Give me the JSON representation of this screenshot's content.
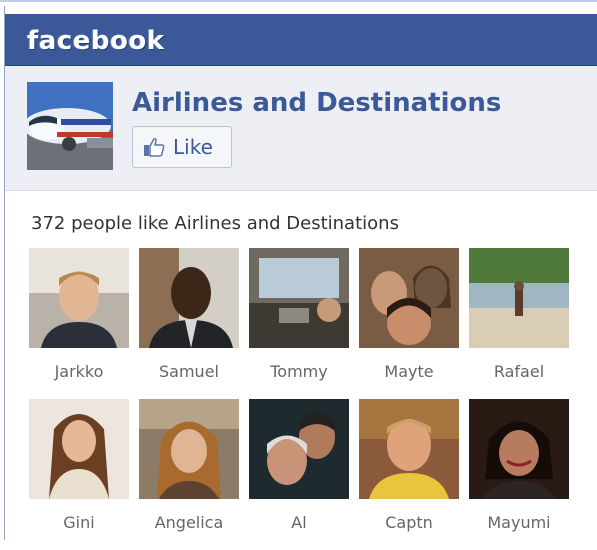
{
  "brand": {
    "logo_text": "facebook",
    "header_color": "#3b5998"
  },
  "page": {
    "name": "Airlines and Destinations",
    "like_label": "Like"
  },
  "fans": {
    "summary": "372 people like Airlines and Destinations",
    "people": [
      {
        "name": "Jarkko"
      },
      {
        "name": "Samuel"
      },
      {
        "name": "Tommy"
      },
      {
        "name": "Mayte"
      },
      {
        "name": "Rafael"
      },
      {
        "name": "Gini"
      },
      {
        "name": "Angelica"
      },
      {
        "name": "Al"
      },
      {
        "name": "Captn"
      },
      {
        "name": "Mayumi"
      }
    ]
  }
}
